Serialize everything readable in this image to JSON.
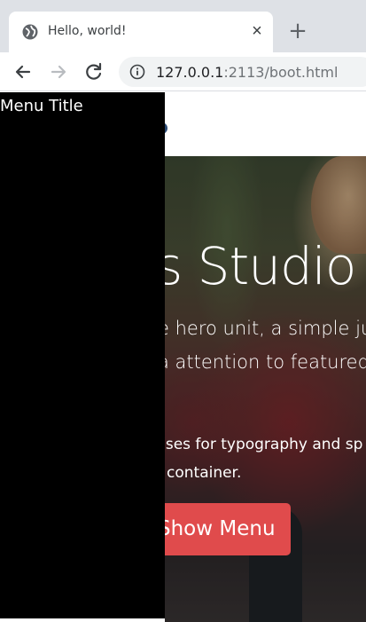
{
  "browser": {
    "tab_title": "Hello, world!",
    "tab_close": "×",
    "new_tab": "+",
    "url_host": "127.0.0.1",
    "url_port": ":2113/boot.html"
  },
  "page": {
    "menu_title": "Menu Title",
    "hero_title": "s Studio",
    "lead_line_1": "e hero unit, a simple ju",
    "lead_line_2": "a attention to featured",
    "para_line_1": "sses for typography and sp",
    "para_line_2": "container.",
    "button_label": "Show Menu"
  },
  "colors": {
    "menu_bg": "#000000",
    "button": "#e04b4c",
    "toggle": "#2b4a73"
  }
}
